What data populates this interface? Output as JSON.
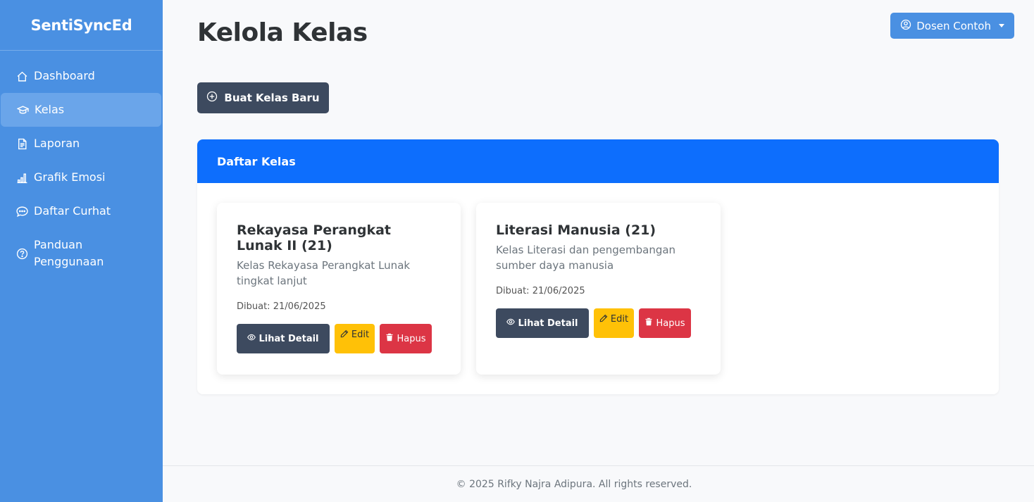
{
  "sidebar": {
    "brand": "SentiSyncEd",
    "items": [
      {
        "label": "Dashboard",
        "icon": "house-icon"
      },
      {
        "label": "Kelas",
        "icon": "mortarboard-icon",
        "active": true
      },
      {
        "label": "Laporan",
        "icon": "file-text-icon"
      },
      {
        "label": "Grafik Emosi",
        "icon": "bar-chart-icon"
      },
      {
        "label": "Daftar Curhat",
        "icon": "chat-dots-icon"
      },
      {
        "label": "Panduan Penggunaan",
        "icon": "question-circle-icon"
      }
    ]
  },
  "header": {
    "title": "Kelola Kelas",
    "user_label": "Dosen Contoh"
  },
  "toolbar": {
    "create_label": "Buat Kelas Baru"
  },
  "panel": {
    "title": "Daftar Kelas",
    "classes": [
      {
        "title": "Rekayasa Perangkat Lunak II (21)",
        "description": "Kelas Rekayasa Perangkat Lunak tingkat lanjut",
        "created": "Dibuat: 21/06/2025"
      },
      {
        "title": "Literasi Manusia (21)",
        "description": "Kelas Literasi dan pengembangan sumber daya manusia",
        "created": "Dibuat: 21/06/2025"
      }
    ],
    "actions": {
      "detail": "Lihat Detail",
      "edit": "Edit",
      "delete": "Hapus"
    }
  },
  "footer": {
    "text": "© 2025 Rifky Najra Adipura. All rights reserved."
  },
  "colors": {
    "sidebar": "#4a90e2",
    "primary": "#0d6efd",
    "dark": "#3d4a5f",
    "warning": "#ffc107",
    "danger": "#dc3545"
  }
}
